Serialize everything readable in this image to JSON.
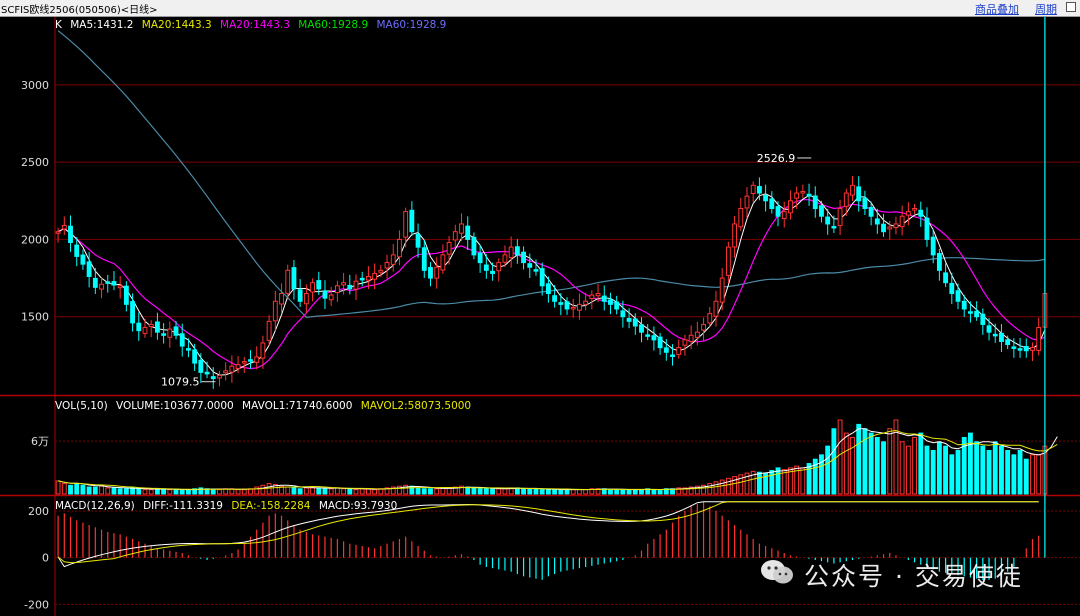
{
  "topbar": {
    "title": "SCFIS欧线2506(050506)<日线>",
    "add_button": "商品叠加",
    "period_button": "周期"
  },
  "price_legend": {
    "k": "K",
    "ma5": "MA5:1431.2",
    "ma20a": "MA20:1443.3",
    "ma20b": "MA20:1443.3",
    "ma60a": "MA60:1928.9",
    "ma60b": "MA60:1928.9"
  },
  "vol_legend": {
    "vol": "VOL(5,10)",
    "volume": "VOLUME:103677.0000",
    "mavol1": "MAVOL1:71740.6000",
    "mavol2": "MAVOL2:58073.5000"
  },
  "macd_legend": {
    "macd": "MACD(12,26,9)",
    "diff": "DIFF:-111.3319",
    "dea": "DEA:-158.2284",
    "val": "MACD:93.7930"
  },
  "watermark": {
    "text": "公众号 · 交易使徒",
    "icon": "wechat-icon"
  },
  "colors": {
    "up": "#ff3232",
    "down": "#00ffff",
    "ma5": "#ffffff",
    "ma20": "#ff00ff",
    "ma60": "#4a8aa6",
    "mavol2": "#e8e800",
    "grid": "#7a0000"
  },
  "chart_data": {
    "type": "candlestick",
    "y_axis": {
      "min": 1000,
      "max": 3400,
      "ticks": [
        1500,
        2000,
        2500,
        3000
      ]
    },
    "volume_axis": {
      "ticks": [
        "6万"
      ],
      "tick_values": [
        60000
      ],
      "max": 110000
    },
    "macd_axis": {
      "min": -250,
      "max": 260,
      "ticks": [
        -200,
        0,
        200
      ]
    },
    "annotations": [
      {
        "label": "2526.9",
        "value": 2526.9,
        "bar": 122
      },
      {
        "label": "1079.5",
        "value": 1079.5,
        "bar": 26
      }
    ],
    "closes": [
      2050,
      2090,
      1980,
      1890,
      1840,
      1760,
      1690,
      1710,
      1720,
      1705,
      1700,
      1580,
      1460,
      1410,
      1430,
      1450,
      1400,
      1380,
      1420,
      1380,
      1310,
      1290,
      1200,
      1140,
      1130,
      1100,
      1120,
      1150,
      1180,
      1190,
      1210,
      1220,
      1240,
      1330,
      1470,
      1600,
      1650,
      1800,
      1680,
      1600,
      1650,
      1720,
      1680,
      1620,
      1640,
      1700,
      1720,
      1680,
      1730,
      1740,
      1760,
      1780,
      1800,
      1850,
      1900,
      2000,
      2180,
      2050,
      1950,
      1800,
      1750,
      1820,
      1900,
      1980,
      2050,
      2100,
      2000,
      1900,
      1850,
      1800,
      1780,
      1850,
      1900,
      1950,
      1900,
      1850,
      1820,
      1800,
      1700,
      1650,
      1600,
      1580,
      1550,
      1560,
      1580,
      1600,
      1640,
      1650,
      1600,
      1580,
      1550,
      1500,
      1470,
      1440,
      1400,
      1380,
      1350,
      1300,
      1270,
      1250,
      1300,
      1350,
      1380,
      1400,
      1450,
      1520,
      1600,
      1750,
      1950,
      2100,
      2200,
      2280,
      2350,
      2300,
      2250,
      2200,
      2150,
      2180,
      2250,
      2300,
      2310,
      2280,
      2200,
      2150,
      2100,
      2080,
      2200,
      2300,
      2350,
      2250,
      2200,
      2150,
      2100,
      2050,
      2080,
      2100,
      2150,
      2180,
      2200,
      2150,
      2000,
      1900,
      1800,
      1720,
      1650,
      1600,
      1550,
      1530,
      1500,
      1450,
      1400,
      1380,
      1340,
      1320,
      1300,
      1290,
      1280,
      1300,
      1430,
      1650
    ],
    "macd_values": [
      180,
      190,
      175,
      160,
      150,
      140,
      130,
      120,
      110,
      105,
      100,
      90,
      80,
      70,
      60,
      50,
      40,
      35,
      30,
      25,
      20,
      10,
      0,
      -5,
      -10,
      -5,
      0,
      10,
      20,
      35,
      60,
      90,
      120,
      150,
      180,
      190,
      180,
      160,
      140,
      120,
      110,
      100,
      95,
      90,
      85,
      80,
      70,
      60,
      55,
      50,
      45,
      40,
      50,
      60,
      70,
      80,
      90,
      70,
      50,
      30,
      10,
      5,
      0,
      5,
      10,
      15,
      5,
      -10,
      -30,
      -40,
      -45,
      -50,
      -55,
      -60,
      -70,
      -80,
      -85,
      -90,
      -95,
      -80,
      -70,
      -60,
      -55,
      -50,
      -45,
      -40,
      -35,
      -30,
      -25,
      -20,
      -15,
      -10,
      0,
      10,
      30,
      60,
      80,
      100,
      120,
      150,
      180,
      200,
      220,
      230,
      240,
      220,
      200,
      180,
      160,
      140,
      120,
      100,
      80,
      60,
      50,
      40,
      30,
      20,
      10,
      5,
      0,
      -5,
      -10,
      -15,
      -20,
      -25,
      -20,
      -15,
      -10,
      -5,
      0,
      5,
      10,
      15,
      20,
      10,
      0,
      -10,
      -20,
      -30,
      -40,
      -50,
      -60,
      -65,
      -70,
      -75,
      -80,
      -85,
      -90,
      -95,
      -95,
      -90,
      -80,
      -60,
      -40,
      0,
      40,
      80,
      94
    ],
    "volumes_relative": [
      0.15,
      0.12,
      0.1,
      0.12,
      0.1,
      0.08,
      0.08,
      0.09,
      0.07,
      0.07,
      0.06,
      0.06,
      0.07,
      0.06,
      0.05,
      0.05,
      0.06,
      0.06,
      0.05,
      0.05,
      0.04,
      0.05,
      0.06,
      0.07,
      0.06,
      0.05,
      0.05,
      0.06,
      0.06,
      0.05,
      0.05,
      0.06,
      0.08,
      0.1,
      0.12,
      0.11,
      0.09,
      0.08,
      0.07,
      0.06,
      0.07,
      0.08,
      0.07,
      0.06,
      0.06,
      0.07,
      0.06,
      0.06,
      0.05,
      0.06,
      0.06,
      0.05,
      0.06,
      0.07,
      0.08,
      0.09,
      0.1,
      0.09,
      0.07,
      0.06,
      0.06,
      0.06,
      0.07,
      0.07,
      0.08,
      0.09,
      0.08,
      0.07,
      0.06,
      0.06,
      0.06,
      0.06,
      0.06,
      0.07,
      0.07,
      0.06,
      0.06,
      0.06,
      0.05,
      0.05,
      0.05,
      0.05,
      0.05,
      0.05,
      0.05,
      0.05,
      0.06,
      0.06,
      0.06,
      0.05,
      0.05,
      0.05,
      0.05,
      0.05,
      0.05,
      0.06,
      0.05,
      0.05,
      0.06,
      0.06,
      0.07,
      0.07,
      0.08,
      0.09,
      0.1,
      0.12,
      0.14,
      0.16,
      0.18,
      0.2,
      0.22,
      0.24,
      0.26,
      0.25,
      0.24,
      0.27,
      0.3,
      0.28,
      0.3,
      0.32,
      0.3,
      0.35,
      0.4,
      0.45,
      0.55,
      0.75,
      0.85,
      0.7,
      0.65,
      0.8,
      0.75,
      0.7,
      0.65,
      0.6,
      0.75,
      0.85,
      0.6,
      0.55,
      0.65,
      0.7,
      0.55,
      0.5,
      0.6,
      0.55,
      0.45,
      0.5,
      0.65,
      0.7,
      0.6,
      0.55,
      0.5,
      0.6,
      0.55,
      0.5,
      0.45,
      0.5,
      0.4,
      0.45,
      0.45,
      0.55,
      0.85,
      1.0
    ]
  }
}
